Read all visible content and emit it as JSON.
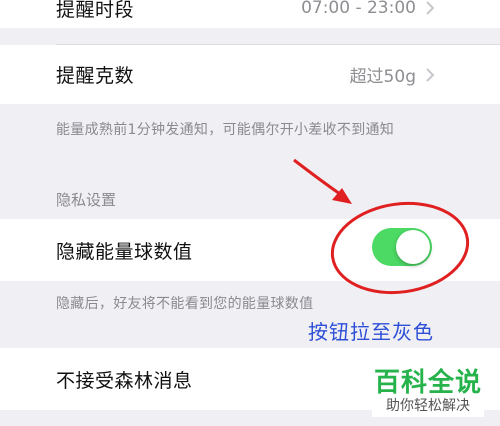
{
  "settings": {
    "remind_period": {
      "label": "提醒时段",
      "value": "07:00 - 23:00"
    },
    "remind_grams": {
      "label": "提醒克数",
      "value": "超过50g"
    },
    "remind_note": "能量成熟前1分钟发通知，可能偶尔开小差收不到通知"
  },
  "privacy": {
    "header": "隐私设置",
    "hide_energy": {
      "label": "隐藏能量球数值",
      "toggle_on": true
    },
    "note": "隐藏后，好友将不能看到您的能量球数值"
  },
  "forest": {
    "label": "不接受森林消息"
  },
  "annotation": {
    "text": "按钮拉至灰色",
    "color": "#e02020"
  },
  "watermark": {
    "title": "百科全说",
    "subtitle": "助你轻松解决"
  },
  "colors": {
    "toggle_on": "#4cd964",
    "background": "#f0eff4"
  }
}
